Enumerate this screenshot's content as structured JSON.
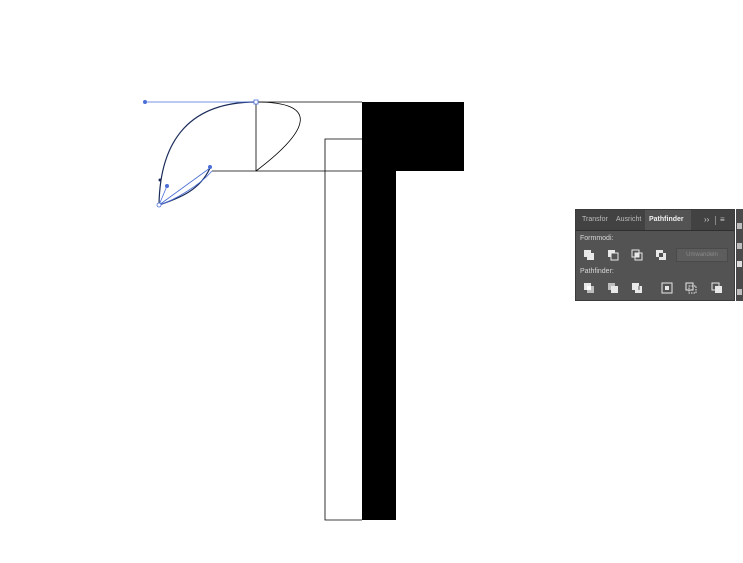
{
  "panel": {
    "tabs": [
      {
        "label": "Transfor",
        "active": false
      },
      {
        "label": "Ausricht",
        "active": false
      },
      {
        "label": "Pathfinder",
        "active": true
      }
    ],
    "more_label": "››",
    "menu_label": "≡",
    "shape_modes_label": "Formmodi:",
    "pathfinders_label": "Pathfinder:",
    "expand_label": "Umwandeln",
    "shape_mode_buttons": [
      "unite-icon",
      "minus-front-icon",
      "intersect-icon",
      "exclude-icon"
    ],
    "pathfinder_buttons": [
      "divide-icon",
      "trim-icon",
      "merge-icon",
      "crop-icon",
      "outline-icon",
      "minus-back-icon"
    ]
  },
  "colors": {
    "selection": "#4a6fd6",
    "panel_bg": "#535353",
    "tab_bar": "#424242",
    "artwork_fill": "#000000"
  }
}
